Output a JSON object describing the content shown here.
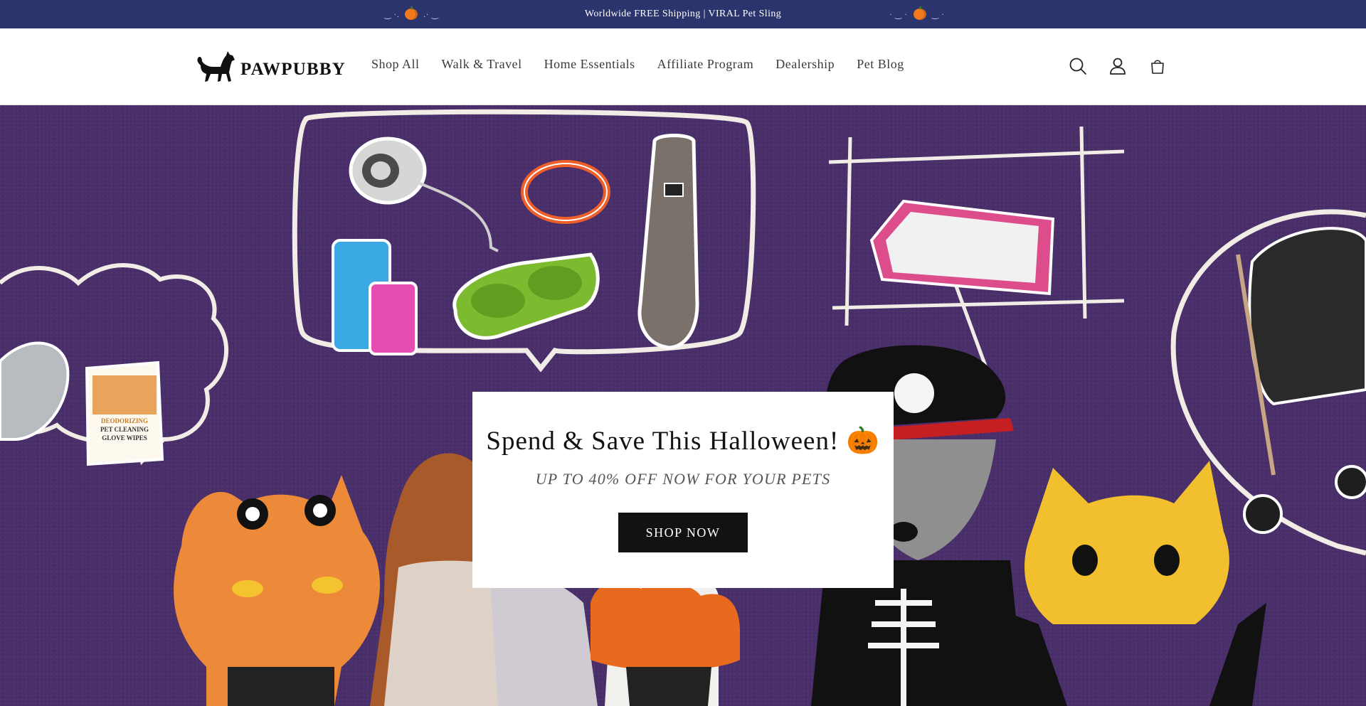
{
  "announcement": {
    "text": "Worldwide FREE Shipping | VIRAL Pet Sling"
  },
  "header": {
    "logo_text": "PAWPUBBY",
    "nav": [
      {
        "label": "Shop All"
      },
      {
        "label": "Walk & Travel"
      },
      {
        "label": "Home Essentials"
      },
      {
        "label": "Affiliate Program"
      },
      {
        "label": "Dealership"
      },
      {
        "label": "Pet Blog"
      }
    ],
    "icons": [
      "search-icon",
      "account-icon",
      "cart-icon"
    ]
  },
  "hero": {
    "product_labels": {
      "wipes_line1": "DEODORIZING",
      "wipes_line2": "PET CLEANING",
      "wipes_line3": "GLOVE WIPES"
    },
    "promo": {
      "title": "Spend & Save This Halloween! 🎃",
      "subtitle": "UP TO 40% OFF NOW FOR YOUR PETS",
      "button_label": "SHOP NOW"
    }
  },
  "colors": {
    "announcement_bg": "#2b346d",
    "hero_bg": "#4a2f6b",
    "button_bg": "#121212",
    "pumpkin": "#f07a1c"
  }
}
